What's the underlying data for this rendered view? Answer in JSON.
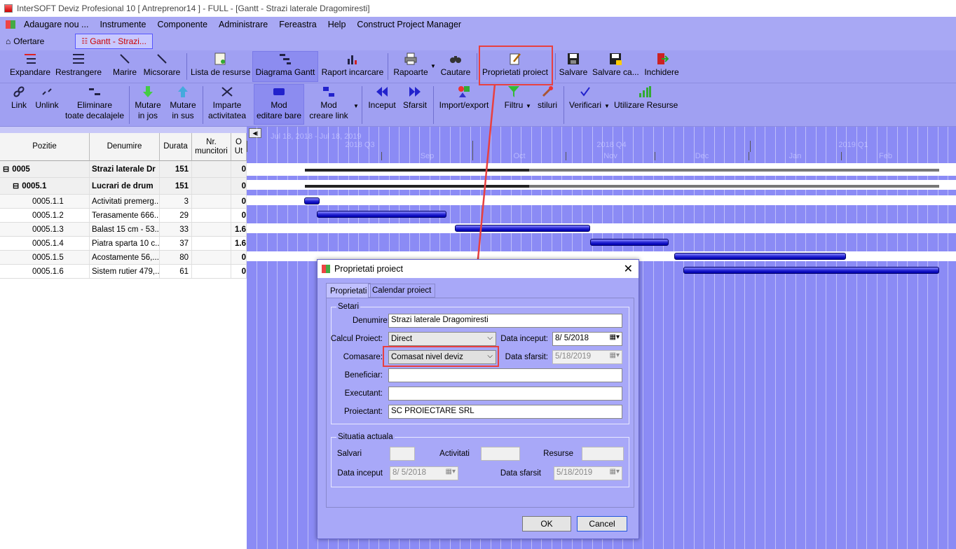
{
  "window": {
    "title": "InterSOFT Deviz Profesional 10 [ Antreprenor14 ] - FULL - [Gantt - Strazi laterale Dragomiresti]"
  },
  "menu": [
    "Adaugare nou ...",
    "Instrumente",
    "Componente",
    "Administrare",
    "Fereastra",
    "Help",
    "Construct Project Manager"
  ],
  "doc_tabs": [
    "Ofertare",
    "Gantt - Strazi..."
  ],
  "toolbar1": {
    "expandare": "Expandare",
    "restrangere": "Restrangere",
    "marire": "Marire",
    "micsorare": "Micsorare",
    "lista_resurse": "Lista de resurse",
    "diagrama_gantt": "Diagrama Gantt",
    "raport_incarcare": "Raport incarcare",
    "rapoarte": "Rapoarte",
    "cautare": "Cautare",
    "proprietati": "Proprietati proiect",
    "salvare": "Salvare",
    "salvare_ca": "Salvare ca...",
    "inchidere": "Inchidere"
  },
  "toolbar2": {
    "link": "Link",
    "unlink": "Unlink",
    "eliminare_1": "Eliminare",
    "eliminare_2": "toate decalajele",
    "mutare_jos_1": "Mutare",
    "mutare_jos_2": "in jos",
    "mutare_sus_1": "Mutare",
    "mutare_sus_2": "in sus",
    "imparte_1": "Imparte",
    "imparte_2": "activitatea",
    "mod_editare_1": "Mod",
    "mod_editare_2": "editare bare",
    "mod_creare_1": "Mod",
    "mod_creare_2": "creare link",
    "inceput": "Inceput",
    "sfarsit": "Sfarsit",
    "import_export": "Import/export",
    "filtru": "Filtru",
    "stiluri": "stiluri",
    "verificari": "Verificari",
    "utilizare_resurse": "Utilizare Resurse"
  },
  "grid": {
    "headers": {
      "pozitie": "Pozitie",
      "denumire": "Denumire",
      "durata": "Durata",
      "nr_muncitori": "Nr. muncitori",
      "ut": "O Ut"
    },
    "rows": [
      {
        "pozitie": "0005",
        "denumire": "Strazi laterale Dr",
        "durata": "151",
        "extra": "0",
        "bold": true,
        "expander": "⊟",
        "indent": 0
      },
      {
        "pozitie": "0005.1",
        "denumire": "Lucrari de drum",
        "durata": "151",
        "extra": "0",
        "bold": true,
        "expander": "⊟",
        "indent": 1
      },
      {
        "pozitie": "0005.1.1",
        "denumire": "Activitati premerg...",
        "durata": "3",
        "extra": "0",
        "bold": false,
        "expander": "",
        "indent": 2
      },
      {
        "pozitie": "0005.1.2",
        "denumire": "Terasamente 666...",
        "durata": "29",
        "extra": "0",
        "bold": false,
        "expander": "",
        "indent": 2
      },
      {
        "pozitie": "0005.1.3",
        "denumire": "Balast 15 cm - 53...",
        "durata": "33",
        "extra": "1.6",
        "bold": false,
        "expander": "",
        "indent": 2
      },
      {
        "pozitie": "0005.1.4",
        "denumire": "Piatra sparta 10 c...",
        "durata": "37",
        "extra": "1.6",
        "bold": false,
        "expander": "",
        "indent": 2
      },
      {
        "pozitie": "0005.1.5",
        "denumire": "Acostamente 56,...",
        "durata": "80",
        "extra": "0",
        "bold": false,
        "expander": "",
        "indent": 2
      },
      {
        "pozitie": "0005.1.6",
        "denumire": "Sistem rutier 479,...",
        "durata": "61",
        "extra": "0",
        "bold": false,
        "expander": "",
        "indent": 2
      }
    ]
  },
  "gantt": {
    "range_label": "Jul 18, 2018 - Jul 18, 2019",
    "quarters": [
      "2018 Q3",
      "2018 Q4",
      "2019 Q1"
    ],
    "months": [
      "Sep",
      "Oct",
      "Nov",
      "Dec",
      "Jan",
      "Feb"
    ]
  },
  "dialog": {
    "title": "Proprietati proiect",
    "tabs": [
      "Proprietati",
      "Calendar proiect"
    ],
    "setari": "Setari",
    "denumire_lbl": "Denumire:",
    "denumire_val": "Strazi laterale Dragomiresti",
    "calcul_lbl": "Calcul Proiect:",
    "calcul_val": "Direct",
    "data_inceput_lbl": "Data inceput:",
    "data_inceput_val": "8/ 5/2018",
    "comasare_lbl": "Comasare:",
    "comasare_val": "Comasat nivel deviz",
    "data_sfarsit_lbl": "Data sfarsit:",
    "data_sfarsit_val": "5/18/2019",
    "beneficiar_lbl": "Beneficiar:",
    "beneficiar_val": "",
    "executant_lbl": "Executant:",
    "executant_val": "",
    "proiectant_lbl": "Proiectant:",
    "proiectant_val": "SC PROIECTARE SRL",
    "situatia": "Situatia actuala",
    "salvari_lbl": "Salvari",
    "activitati_lbl": "Activitati",
    "resurse_lbl": "Resurse",
    "s_data_inceput_lbl": "Data inceput",
    "s_data_inceput_val": "8/ 5/2018",
    "s_data_sfarsit_lbl": "Data sfarsit",
    "s_data_sfarsit_val": "5/18/2019",
    "ok": "OK",
    "cancel": "Cancel"
  },
  "colors": {
    "accent": "#e84040",
    "gantt_bg": "#8b8bf5",
    "bar": "#1a1acc"
  }
}
